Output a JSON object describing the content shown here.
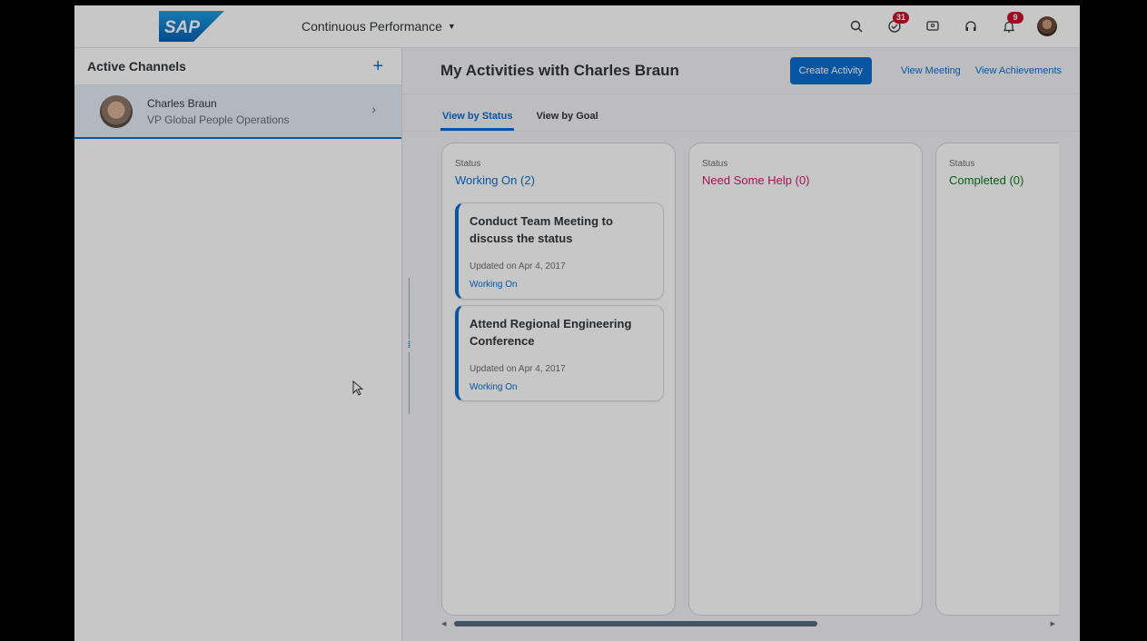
{
  "shell": {
    "logo_text": "SAP",
    "app_title": "Continuous Performance",
    "icons": [
      {
        "name": "search-icon"
      },
      {
        "name": "todo-icon",
        "badge": "31"
      },
      {
        "name": "feedback-icon"
      },
      {
        "name": "headset-icon"
      },
      {
        "name": "notification-icon",
        "badge": "9"
      },
      {
        "name": "user-avatar"
      }
    ]
  },
  "left_pane": {
    "title": "Active Channels",
    "add_symbol": "+",
    "channels": [
      {
        "name": "Charles Braun",
        "role": "VP Global People Operations",
        "chevron": "›"
      }
    ]
  },
  "right_pane": {
    "title": "My Activities with Charles Braun",
    "actions": {
      "create": "Create Activity",
      "meeting": "View Meeting",
      "achievements": "View Achievements"
    },
    "tabs": [
      {
        "label": "View by Status",
        "active": true
      },
      {
        "label": "View by Goal",
        "active": false
      }
    ],
    "columns": [
      {
        "label": "Status",
        "title": "Working On (2)",
        "color": "#0a6ed1",
        "cards": [
          {
            "title": "Conduct Team Meeting to discuss the status",
            "date": "Updated on Apr 4, 2017",
            "status": "Working On"
          },
          {
            "title": "Attend Regional Engineering Conference",
            "date": "Updated on Apr 4, 2017",
            "status": "Working On"
          }
        ]
      },
      {
        "label": "Status",
        "title": "Need Some Help (0)",
        "color": "#d01b6b",
        "cards": []
      },
      {
        "label": "Status",
        "title": "Completed (0)",
        "color": "#0b7a1e",
        "cards": []
      }
    ]
  },
  "colors": {
    "accent": "#0a6ed1",
    "help": "#d01b6b",
    "completed": "#0b7a1e",
    "badge": "#c8102e"
  }
}
